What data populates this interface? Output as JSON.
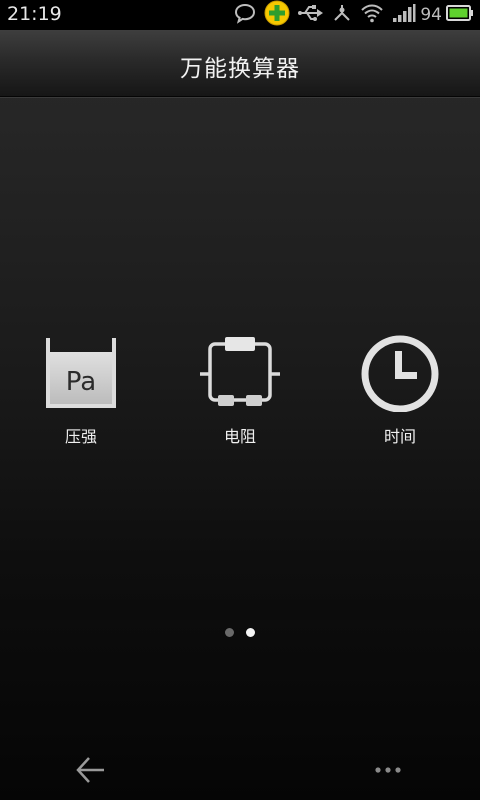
{
  "status_bar": {
    "time": "21:19",
    "battery_percent": "94",
    "icons": [
      "chat-bubble-icon",
      "security-app-icon",
      "usb-icon",
      "usb-debug-icon",
      "wifi-icon",
      "signal-icon",
      "battery-icon"
    ]
  },
  "header": {
    "title": "万能换算器"
  },
  "grid": {
    "items": [
      {
        "label": "压强",
        "icon": "pressure-pa-icon",
        "icon_text": "Pa"
      },
      {
        "label": "电阻",
        "icon": "resistor-icon"
      },
      {
        "label": "时间",
        "icon": "clock-icon"
      }
    ]
  },
  "pagination": {
    "current_page": 2,
    "total_pages": 2
  },
  "bottom_bar": {
    "icons": [
      "back-arrow-icon",
      "more-dots-icon"
    ]
  },
  "colors": {
    "battery_fill": "#5fd12e",
    "security_icon": "#f5c800",
    "security_cross": "#2e9e2e"
  }
}
